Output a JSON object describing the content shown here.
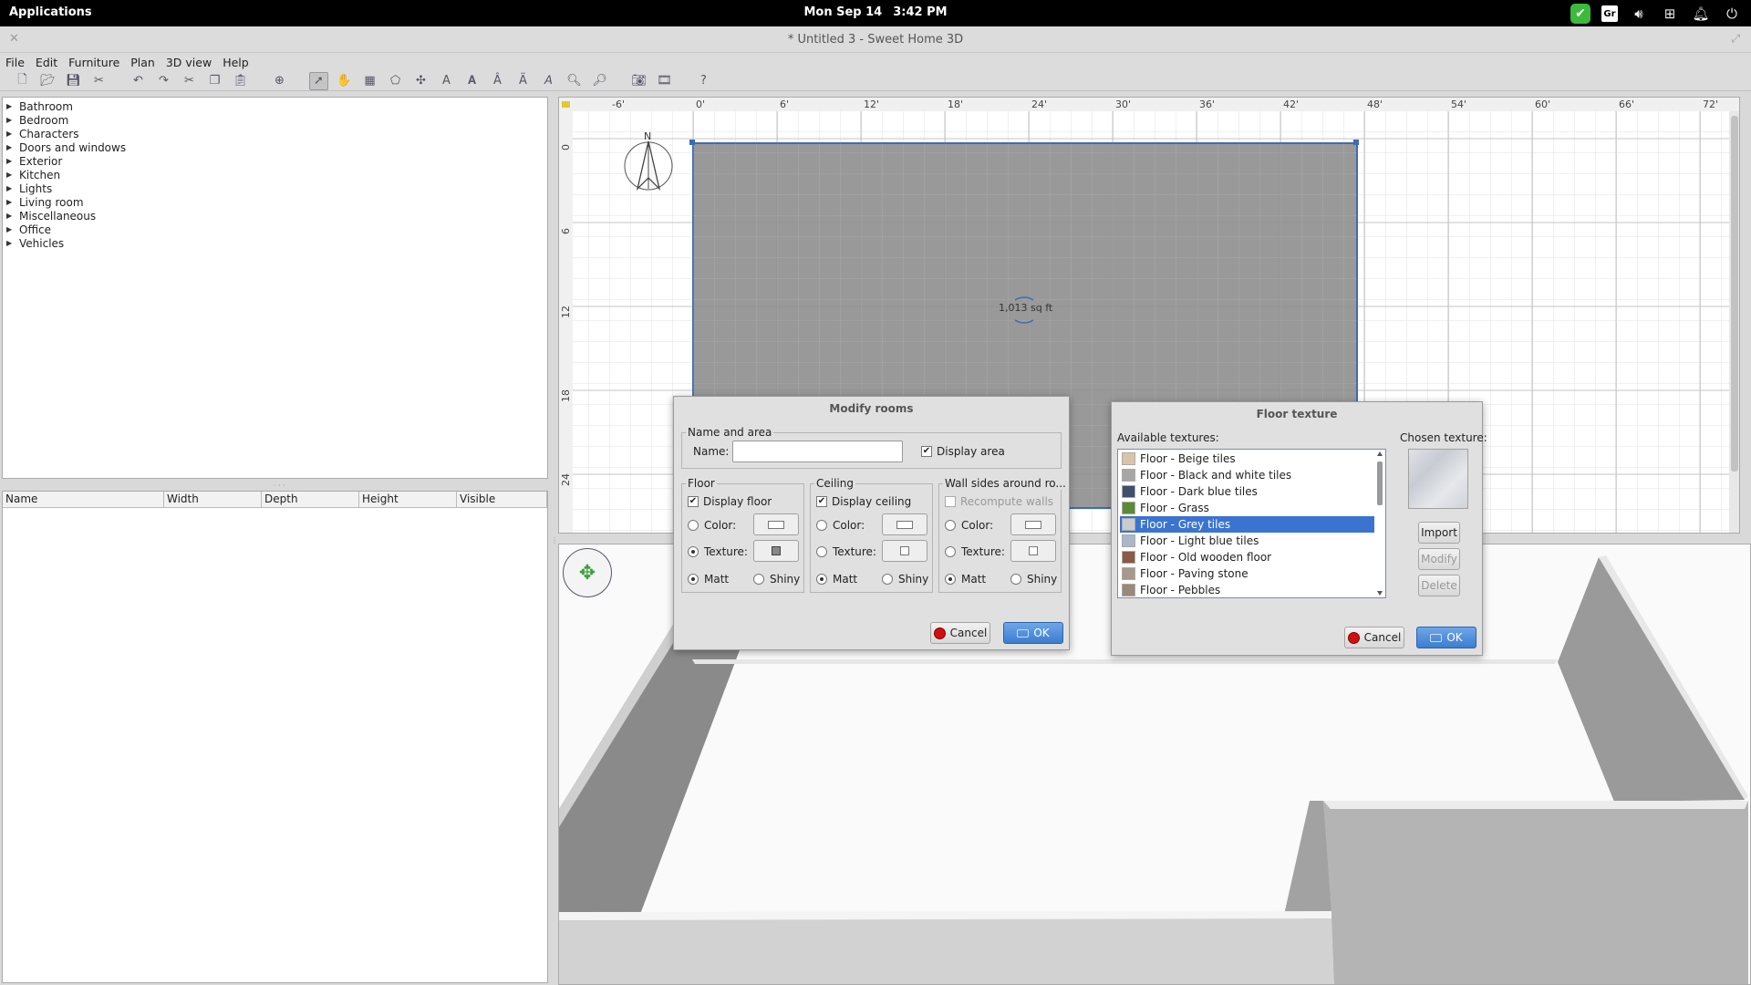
{
  "topbar": {
    "applications": "Applications",
    "date": "Mon Sep 14",
    "time": "3:42 PM",
    "tray_icons": [
      "shield-check-icon",
      "gr-icon",
      "volume-icon",
      "network-icon",
      "bell-icon",
      "power-icon"
    ],
    "gr_label": "Gr"
  },
  "window": {
    "title": "* Untitled 3 - Sweet Home 3D"
  },
  "menu": [
    "File",
    "Edit",
    "Furniture",
    "Plan",
    "3D view",
    "Help"
  ],
  "catalog": {
    "categories": [
      "Bathroom",
      "Bedroom",
      "Characters",
      "Doors and windows",
      "Exterior",
      "Kitchen",
      "Lights",
      "Living room",
      "Miscellaneous",
      "Office",
      "Vehicles"
    ]
  },
  "furniture_table": {
    "columns": [
      "Name",
      "Width",
      "Depth",
      "Height",
      "Visible"
    ]
  },
  "plan": {
    "ruler_top": [
      "-6'",
      "0'",
      "6'",
      "12'",
      "18'",
      "24'",
      "30'",
      "36'",
      "42'",
      "48'",
      "54'",
      "60'",
      "66'",
      "72'"
    ],
    "ruler_left": [
      "0",
      "6",
      "12",
      "18",
      "24"
    ],
    "compass_label": "N",
    "room_area": "1,013 sq ft"
  },
  "modify_rooms": {
    "title": "Modify rooms",
    "name_area_group": "Name and area",
    "name_label": "Name:",
    "name_value": "",
    "display_area_label": "Display area",
    "display_area_checked": true,
    "floor": {
      "group": "Floor",
      "display_label": "Display floor",
      "display_checked": true,
      "color_label": "Color:",
      "texture_label": "Texture:",
      "selected": "texture",
      "matt_label": "Matt",
      "shiny_label": "Shiny",
      "finish": "matt"
    },
    "ceiling": {
      "group": "Ceiling",
      "display_label": "Display ceiling",
      "display_checked": true,
      "color_label": "Color:",
      "texture_label": "Texture:",
      "matt_label": "Matt",
      "shiny_label": "Shiny",
      "finish": "matt"
    },
    "walls": {
      "group": "Wall sides around ro...",
      "recompute_label": "Recompute walls",
      "color_label": "Color:",
      "texture_label": "Texture:",
      "matt_label": "Matt",
      "shiny_label": "Shiny",
      "finish": "matt"
    },
    "cancel_label": "Cancel",
    "ok_label": "OK"
  },
  "floor_texture": {
    "title": "Floor texture",
    "available_label": "Available textures:",
    "chosen_label": "Chosen texture:",
    "textures": [
      {
        "name": "Floor - Beige tiles",
        "color": "#d9c4a8"
      },
      {
        "name": "Floor - Black and white tiles",
        "color": "#a6a6a6"
      },
      {
        "name": "Floor - Dark blue tiles",
        "color": "#3e4e6c"
      },
      {
        "name": "Floor - Grass",
        "color": "#5b8a34"
      },
      {
        "name": "Floor - Grey tiles",
        "color": "#c8ccd2"
      },
      {
        "name": "Floor - Light blue tiles",
        "color": "#aab7c8"
      },
      {
        "name": "Floor - Old wooden floor",
        "color": "#8a5a44"
      },
      {
        "name": "Floor - Paving stone",
        "color": "#a8978a"
      },
      {
        "name": "Floor - Pebbles",
        "color": "#9a8878"
      }
    ],
    "selected_index": 4,
    "import_label": "Import",
    "modify_label": "Modify",
    "delete_label": "Delete",
    "cancel_label": "Cancel",
    "ok_label": "OK"
  }
}
